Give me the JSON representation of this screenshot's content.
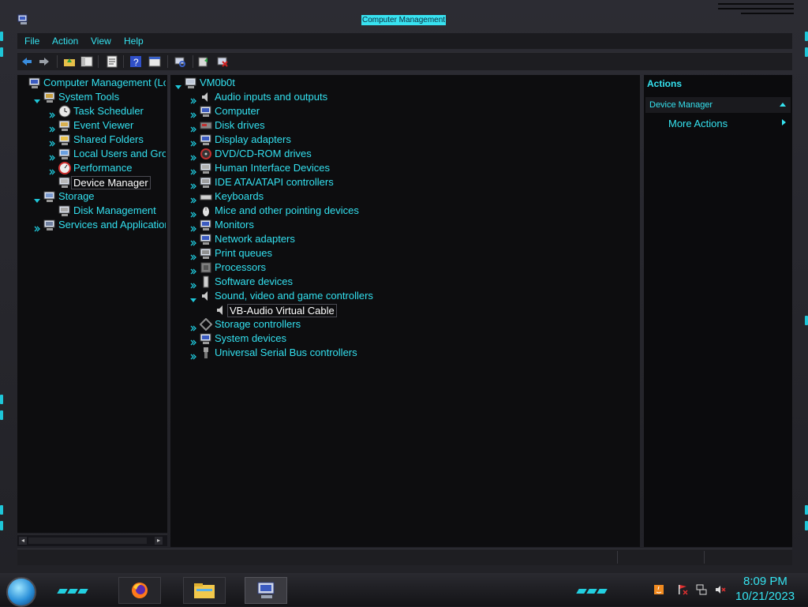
{
  "window": {
    "title": "Computer Management"
  },
  "menu": [
    "File",
    "Action",
    "View",
    "Help"
  ],
  "toolbar": {
    "buttons": [
      "back-icon",
      "forward-icon",
      "up-folder-icon",
      "show-hide-tree-icon",
      "properties-icon",
      "help-icon",
      "console-view-icon",
      "scan-hardware-icon",
      "update-driver-icon",
      "uninstall-device-icon"
    ]
  },
  "left_tree": [
    {
      "label": "Computer Management (Local)",
      "level": 0,
      "icon": "computer-management-icon",
      "expander": "none"
    },
    {
      "label": "System Tools",
      "level": 1,
      "icon": "system-tools-icon",
      "expander": "expanded"
    },
    {
      "label": "Task Scheduler",
      "level": 2,
      "icon": "clock-icon",
      "expander": "collapsed"
    },
    {
      "label": "Event Viewer",
      "level": 2,
      "icon": "event-viewer-icon",
      "expander": "collapsed"
    },
    {
      "label": "Shared Folders",
      "level": 2,
      "icon": "shared-folder-icon",
      "expander": "collapsed"
    },
    {
      "label": "Local Users and Groups",
      "level": 2,
      "icon": "users-icon",
      "expander": "collapsed"
    },
    {
      "label": "Performance",
      "level": 2,
      "icon": "performance-icon",
      "expander": "collapsed"
    },
    {
      "label": "Device Manager",
      "level": 2,
      "icon": "device-manager-icon",
      "expander": "none",
      "selected": true
    },
    {
      "label": "Storage",
      "level": 1,
      "icon": "storage-icon",
      "expander": "expanded"
    },
    {
      "label": "Disk Management",
      "level": 2,
      "icon": "disk-management-icon",
      "expander": "none"
    },
    {
      "label": "Services and Applications",
      "level": 1,
      "icon": "services-icon",
      "expander": "collapsed"
    }
  ],
  "device_tree": [
    {
      "label": "VM0b0t",
      "level": 0,
      "icon": "computer-icon",
      "expander": "expanded"
    },
    {
      "label": "Audio inputs and outputs",
      "level": 1,
      "icon": "speaker-icon",
      "expander": "collapsed"
    },
    {
      "label": "Computer",
      "level": 1,
      "icon": "monitor-icon",
      "expander": "collapsed"
    },
    {
      "label": "Disk drives",
      "level": 1,
      "icon": "disk-drive-icon",
      "expander": "collapsed"
    },
    {
      "label": "Display adapters",
      "level": 1,
      "icon": "display-adapter-icon",
      "expander": "collapsed"
    },
    {
      "label": "DVD/CD-ROM drives",
      "level": 1,
      "icon": "dvd-icon",
      "expander": "collapsed"
    },
    {
      "label": "Human Interface Devices",
      "level": 1,
      "icon": "hid-icon",
      "expander": "collapsed"
    },
    {
      "label": "IDE ATA/ATAPI controllers",
      "level": 1,
      "icon": "ide-controller-icon",
      "expander": "collapsed"
    },
    {
      "label": "Keyboards",
      "level": 1,
      "icon": "keyboard-icon",
      "expander": "collapsed"
    },
    {
      "label": "Mice and other pointing devices",
      "level": 1,
      "icon": "mouse-icon",
      "expander": "collapsed"
    },
    {
      "label": "Monitors",
      "level": 1,
      "icon": "monitor-icon",
      "expander": "collapsed"
    },
    {
      "label": "Network adapters",
      "level": 1,
      "icon": "network-adapter-icon",
      "expander": "collapsed"
    },
    {
      "label": "Print queues",
      "level": 1,
      "icon": "printer-icon",
      "expander": "collapsed"
    },
    {
      "label": "Processors",
      "level": 1,
      "icon": "processor-icon",
      "expander": "collapsed"
    },
    {
      "label": "Software devices",
      "level": 1,
      "icon": "software-device-icon",
      "expander": "collapsed"
    },
    {
      "label": "Sound, video and game controllers",
      "level": 1,
      "icon": "speaker-icon",
      "expander": "expanded"
    },
    {
      "label": "VB-Audio Virtual Cable",
      "level": 2,
      "icon": "speaker-icon",
      "expander": "none",
      "selected": true
    },
    {
      "label": "Storage controllers",
      "level": 1,
      "icon": "storage-controller-icon",
      "expander": "collapsed"
    },
    {
      "label": "System devices",
      "level": 1,
      "icon": "system-devices-icon",
      "expander": "collapsed"
    },
    {
      "label": "Universal Serial Bus controllers",
      "level": 1,
      "icon": "usb-icon",
      "expander": "collapsed"
    }
  ],
  "actions": {
    "header": "Actions",
    "section": "Device Manager",
    "items": [
      "More Actions"
    ]
  },
  "taskbar": {
    "buttons": [
      "firefox-icon",
      "file-explorer-icon",
      "computer-management-icon"
    ],
    "tray": [
      "java-icon",
      "flag-icon",
      "network-icon",
      "volume-muted-icon"
    ],
    "time": "8:09 PM",
    "date": "10/21/2023"
  },
  "colors": {
    "accent": "#35e3f0",
    "background": "#0d0d0f",
    "selected_text": "#ffffff"
  }
}
